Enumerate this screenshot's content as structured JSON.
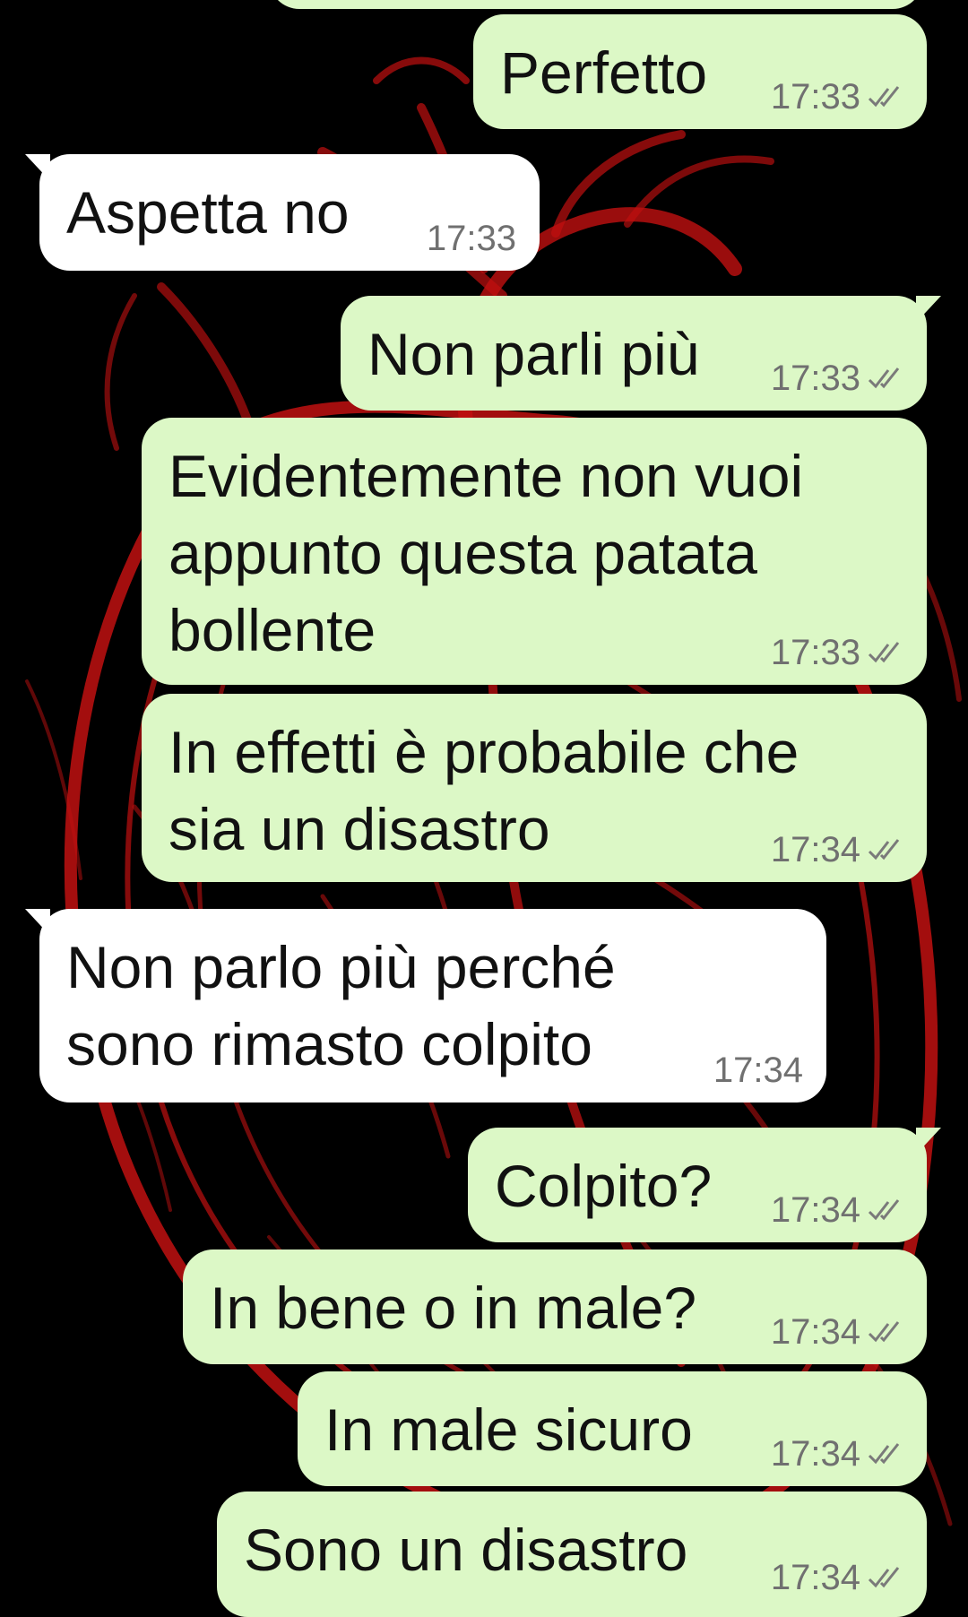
{
  "wallpaper": {
    "background_color": "#000000",
    "artwork_color": "#c01010",
    "artwork_icon": "anatomical-heart-drawing"
  },
  "colors": {
    "outgoing_bubble": "#dcf8c6",
    "incoming_bubble": "#ffffff",
    "timestamp": "#707070",
    "read_ticks": "#7a7a7a"
  },
  "messages": [
    {
      "direction": "outgoing",
      "text": "Perfetto",
      "time": "17:33",
      "ticks_icon": "double-check-icon"
    },
    {
      "direction": "incoming",
      "text": "Aspetta no",
      "time": "17:33"
    },
    {
      "direction": "outgoing",
      "text": "Non parli più",
      "time": "17:33",
      "ticks_icon": "double-check-icon"
    },
    {
      "direction": "outgoing",
      "text": "Evidentemente non vuoi appunto questa patata bollente",
      "time": "17:33",
      "ticks_icon": "double-check-icon"
    },
    {
      "direction": "outgoing",
      "text": "In effetti è probabile che sia un disastro",
      "time": "17:34",
      "ticks_icon": "double-check-icon"
    },
    {
      "direction": "incoming",
      "text": "Non parlo più perché sono rimasto colpito",
      "time": "17:34"
    },
    {
      "direction": "outgoing",
      "text": "Colpito?",
      "time": "17:34",
      "ticks_icon": "double-check-icon"
    },
    {
      "direction": "outgoing",
      "text": "In bene o in male?",
      "time": "17:34",
      "ticks_icon": "double-check-icon"
    },
    {
      "direction": "outgoing",
      "text": "In male sicuro",
      "time": "17:34",
      "ticks_icon": "double-check-icon"
    },
    {
      "direction": "outgoing",
      "text": "Sono un disastro",
      "time": "17:34",
      "ticks_icon": "double-check-icon"
    }
  ]
}
